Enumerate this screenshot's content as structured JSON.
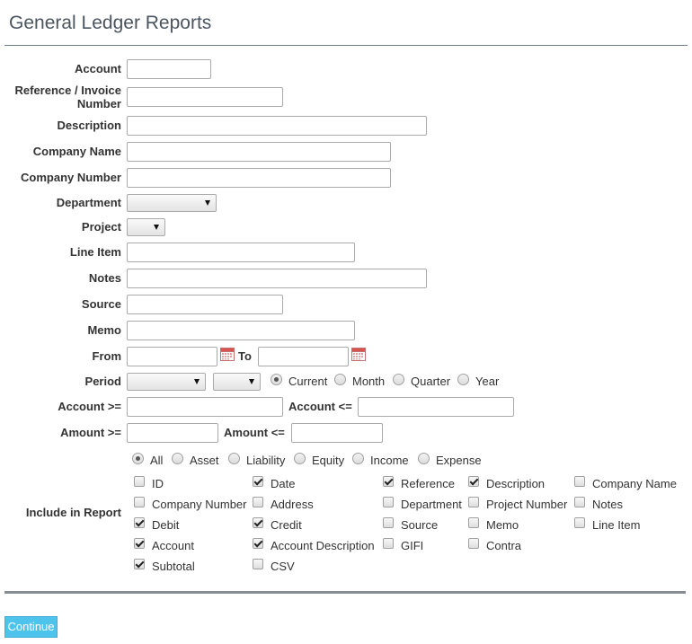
{
  "page": {
    "title": "General Ledger Reports"
  },
  "labels": {
    "account": "Account",
    "reference": "Reference / Invoice Number",
    "description": "Description",
    "company_name": "Company Name",
    "company_number": "Company Number",
    "department": "Department",
    "project": "Project",
    "line_item": "Line Item",
    "notes": "Notes",
    "source": "Source",
    "memo": "Memo",
    "from": "From",
    "to": "To",
    "period": "Period",
    "account_gte": "Account >=",
    "account_lte": "Account <=",
    "amount_gte": "Amount >=",
    "amount_lte": "Amount <=",
    "include_in_report": "Include in Report"
  },
  "fields": {
    "account": "",
    "reference": "",
    "description": "",
    "company_name": "",
    "company_number": "",
    "line_item": "",
    "notes": "",
    "source": "",
    "memo": "",
    "from": "",
    "to": "",
    "account_gte": "",
    "account_lte": "",
    "amount_gte": "",
    "amount_lte": "",
    "department_selected": "",
    "project_selected": "",
    "period_year_selected": "",
    "period_month_selected": ""
  },
  "period_options": [
    {
      "label": "Current",
      "checked": true
    },
    {
      "label": "Month",
      "checked": false
    },
    {
      "label": "Quarter",
      "checked": false
    },
    {
      "label": "Year",
      "checked": false
    }
  ],
  "type_options": [
    {
      "label": "All",
      "checked": true
    },
    {
      "label": "Asset",
      "checked": false
    },
    {
      "label": "Liability",
      "checked": false
    },
    {
      "label": "Equity",
      "checked": false
    },
    {
      "label": "Income",
      "checked": false
    },
    {
      "label": "Expense",
      "checked": false
    }
  ],
  "columns": [
    {
      "label": "ID",
      "checked": false
    },
    {
      "label": "Date",
      "checked": true
    },
    {
      "label": "Reference",
      "checked": true
    },
    {
      "label": "Description",
      "checked": true
    },
    {
      "label": "Company Name",
      "checked": false
    },
    {
      "label": "Company Number",
      "checked": false
    },
    {
      "label": "Address",
      "checked": false
    },
    {
      "label": "Department",
      "checked": false
    },
    {
      "label": "Project Number",
      "checked": false
    },
    {
      "label": "Notes",
      "checked": false
    },
    {
      "label": "Debit",
      "checked": true
    },
    {
      "label": "Credit",
      "checked": true
    },
    {
      "label": "Source",
      "checked": false
    },
    {
      "label": "Memo",
      "checked": false
    },
    {
      "label": "Line Item",
      "checked": false
    },
    {
      "label": "Account",
      "checked": true
    },
    {
      "label": "Account Description",
      "checked": true
    },
    {
      "label": "GIFI",
      "checked": false
    },
    {
      "label": "Contra",
      "checked": false
    },
    {
      "label": "Subtotal",
      "checked": true
    },
    {
      "label": "CSV",
      "checked": false
    }
  ],
  "actions": {
    "continue_label": "Continue"
  },
  "icons": {
    "from_calendar": "calendar-icon",
    "to_calendar": "calendar-icon"
  }
}
